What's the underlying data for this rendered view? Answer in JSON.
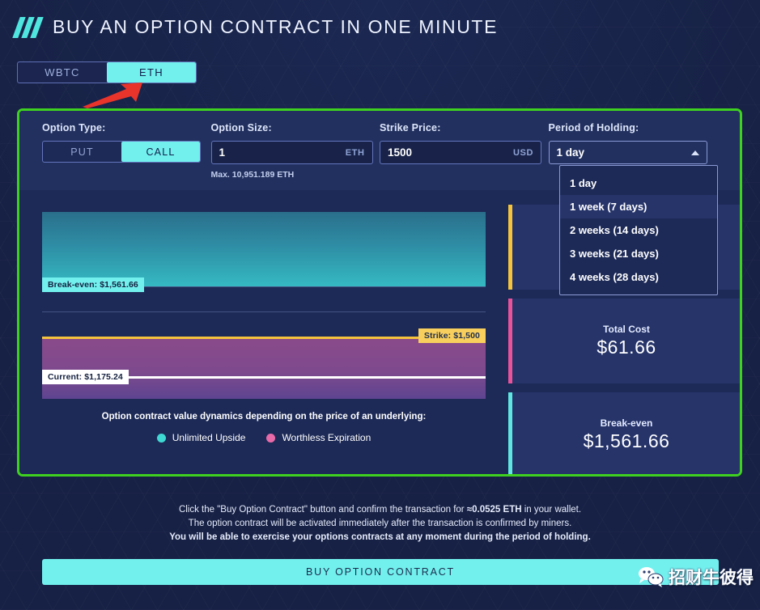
{
  "header": {
    "title": "BUY AN OPTION CONTRACT IN ONE MINUTE",
    "logo_icon": "triple-slash-icon"
  },
  "asset_tabs": [
    {
      "label": "WBTC",
      "active": false
    },
    {
      "label": "ETH",
      "active": true
    }
  ],
  "annotation": {
    "arrow_icon": "red-arrow-icon",
    "color": "#e8342a",
    "points_to": "ETH"
  },
  "form": {
    "option_type": {
      "label": "Option Type:",
      "options": [
        {
          "label": "PUT",
          "active": false
        },
        {
          "label": "CALL",
          "active": true
        }
      ]
    },
    "option_size": {
      "label": "Option Size:",
      "value": "1",
      "unit": "ETH",
      "hint": "Max. 10,951.189 ETH"
    },
    "strike_price": {
      "label": "Strike Price:",
      "value": "1500",
      "unit": "USD"
    },
    "period": {
      "label": "Period of Holding:",
      "selected": "1 day",
      "caret_icon": "chevron-up-icon",
      "expanded": true,
      "options": [
        {
          "label": "1 day",
          "highlighted": false
        },
        {
          "label": "1 week (7 days)",
          "highlighted": true
        },
        {
          "label": "2 weeks (14 days)",
          "highlighted": false
        },
        {
          "label": "3 weeks (21 days)",
          "highlighted": false
        },
        {
          "label": "4 weeks (28 days)",
          "highlighted": false
        }
      ]
    }
  },
  "chart_data": {
    "type": "area",
    "title": "Option contract value dynamics depending on the price of an underlying:",
    "xlabel": "",
    "ylabel": "",
    "grid": true,
    "legend_position": "bottom",
    "markers": [
      {
        "name": "Break-even",
        "label": "Break-even: $1,561.66",
        "value": 1561.66,
        "color": "#72f0ee"
      },
      {
        "name": "Strike",
        "label": "Strike: $1,500",
        "value": 1500,
        "color": "#f8cf5c"
      },
      {
        "name": "Current",
        "label": "Current: $1,175.24",
        "value": 1175.24,
        "color": "#ffffff"
      }
    ],
    "series": [
      {
        "name": "Unlimited Upside",
        "color": "#3fd8d2",
        "region": "above-break-even"
      },
      {
        "name": "Worthless Expiration",
        "color": "#e86aa8",
        "region": "below-strike"
      }
    ],
    "legend": [
      {
        "label": "Unlimited Upside",
        "color": "#3fd8d2"
      },
      {
        "label": "Worthless Expiration",
        "color": "#e86aa8"
      }
    ]
  },
  "cards": [
    {
      "label": "",
      "value": "",
      "accent": "#f5c33c",
      "occluded": true
    },
    {
      "label": "Total Cost",
      "value": "$61.66",
      "accent": "#e8539a"
    },
    {
      "label": "Break-even",
      "value": "$1,561.66",
      "accent": "#5fe6e0"
    }
  ],
  "footer": {
    "line1_a": "Click the \"Buy Option Contract\" button and confirm the transaction for ",
    "line1_b": "≈0.0525 ETH",
    "line1_c": " in your wallet.",
    "line2": "The option contract will be activated immediately after the transaction is confirmed by miners.",
    "line3": "You will be able to exercise your options contracts at any moment during the period of holding.",
    "buy_button": "BUY OPTION CONTRACT"
  },
  "watermark": {
    "text": "招财牛彼得",
    "icon": "wechat-icon"
  }
}
